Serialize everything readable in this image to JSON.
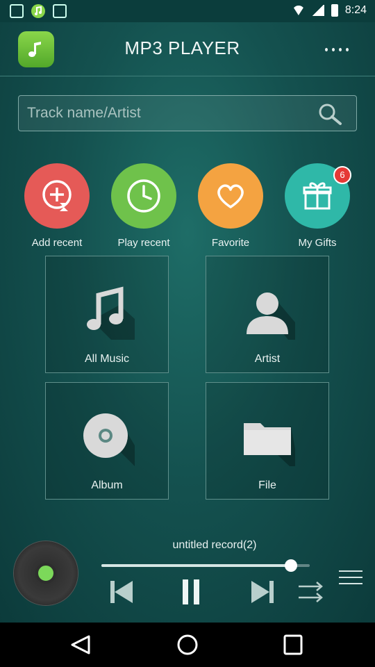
{
  "status_bar": {
    "time": "8:24"
  },
  "header": {
    "title": "MP3 PLAYER",
    "logo_icon": "music-note-icon",
    "menu_icon": "more-dots-icon"
  },
  "search": {
    "placeholder": "Track name/Artist",
    "value": ""
  },
  "quick_actions": [
    {
      "label": "Add recent",
      "icon": "add-hourglass-icon",
      "color": "#e55a57"
    },
    {
      "label": "Play recent",
      "icon": "clock-icon",
      "color": "#6fc24b"
    },
    {
      "label": "Favorite",
      "icon": "heart-icon",
      "color": "#f4a341"
    },
    {
      "label": "My Gifts",
      "icon": "gift-icon",
      "color": "#2fb8a8",
      "badge": "6"
    }
  ],
  "library": [
    {
      "label": "All Music",
      "icon": "music-note-icon"
    },
    {
      "label": "Artist",
      "icon": "person-icon"
    },
    {
      "label": "Album",
      "icon": "disc-icon"
    },
    {
      "label": "File",
      "icon": "folder-icon"
    }
  ],
  "player": {
    "track_title": "untitled record(2)",
    "progress": 0.91,
    "state": "playing"
  },
  "colors": {
    "accent": "#7cd85a",
    "background": "#14514f"
  }
}
